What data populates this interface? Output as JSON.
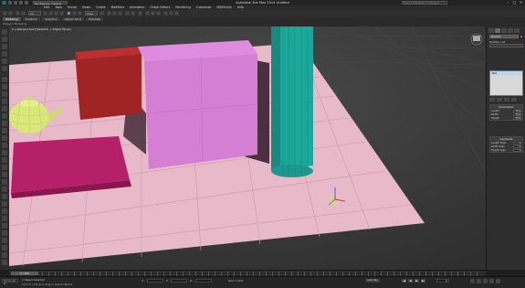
{
  "titlebar": {
    "title": "Autodesk 3ds Max  2015    Untitled",
    "workspace": "Workspace: Default",
    "search_placeholder": "Type a keyword or phrase",
    "minimize": "–",
    "maximize": "□",
    "close": "×"
  },
  "menu": [
    "Edit",
    "Tools",
    "Group",
    "Views",
    "Create",
    "Modifiers",
    "Animation",
    "Graph Editors",
    "Rendering",
    "Customize",
    "MAXScript",
    "Help"
  ],
  "toolbar": {
    "selection_filter": "All",
    "refcoord": "View"
  },
  "ribbon": {
    "tabs": [
      "Modeling",
      "Freeform",
      "Selection",
      "Object Paint",
      "Populate"
    ],
    "active_tab": "Modeling",
    "subtitle": "Polygon Modeling"
  },
  "viewport": {
    "label": "[+] [Perspective] [Realistic + Edged Faces]",
    "stats": [
      "Total",
      "Polys:  1,420",
      "Verts:  722",
      "FPS:    60.0"
    ]
  },
  "command_panel": {
    "object_name": "Box001",
    "modifier_list_label": "Modifier List",
    "stack_item": "Box",
    "params_title": "Parameters",
    "params": [
      {
        "label": "Length:",
        "value": "40.0"
      },
      {
        "label": "Width:",
        "value": "40.0"
      },
      {
        "label": "Height:",
        "value": "40.0"
      }
    ],
    "segs_title": "Segments",
    "segs": [
      {
        "label": "Length Segs:",
        "value": "1"
      },
      {
        "label": "Width Segs:",
        "value": "1"
      },
      {
        "label": "Height Segs:",
        "value": "1"
      }
    ]
  },
  "trackbar": {
    "slider": "0 / 100"
  },
  "statusbar": {
    "maxscript": "MAXScript Mi",
    "selection": "1 Object Selected",
    "prompt": "Click or click-and-drag to select objects",
    "x_label": "X:",
    "x_value": "",
    "y_label": "Y:",
    "y_value": "",
    "z_label": "Z:",
    "z_value": "",
    "grid": "Grid = 10.0",
    "autokey": "Auto Key",
    "frame": "0",
    "play_controls": [
      "|◀",
      "◀",
      "▶",
      "▶|"
    ]
  },
  "colors": {
    "floor": "#e8b9c8",
    "pink_box": "#d47fd4",
    "red_box": "#a02424",
    "magenta_slab": "#b61f6a",
    "cylinder": "#1aa89a",
    "teapot": "#d8e87a"
  }
}
